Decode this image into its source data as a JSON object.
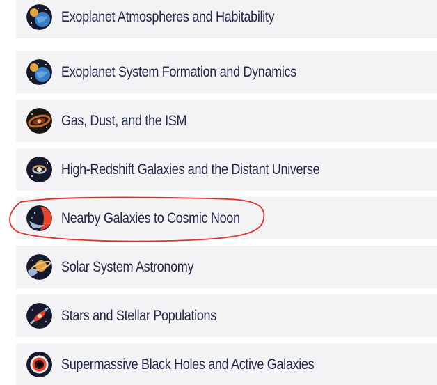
{
  "topics": [
    {
      "label": "Exoplanet Atmospheres and Habitability",
      "icon": "exoplanet-icon"
    },
    {
      "label": "Exoplanet System Formation and Dynamics",
      "icon": "exoplanet-system-icon"
    },
    {
      "label": "Gas, Dust, and the ISM",
      "icon": "nebula-icon"
    },
    {
      "label": "High-Redshift Galaxies and the Distant Universe",
      "icon": "spiral-galaxy-icon"
    },
    {
      "label": "Nearby Galaxies to Cosmic Noon",
      "icon": "cosmic-noon-icon"
    },
    {
      "label": "Solar System Astronomy",
      "icon": "saturn-icon"
    },
    {
      "label": "Stars and Stellar Populations",
      "icon": "star-burst-icon"
    },
    {
      "label": "Supermassive Black Holes and Active Galaxies",
      "icon": "black-hole-icon"
    }
  ],
  "highlight": {
    "color": "#e0342c",
    "target": "Nearby Galaxies to Cosmic Noon"
  },
  "colors": {
    "row_bg": "#f3f3f6",
    "text": "#1f2747"
  }
}
